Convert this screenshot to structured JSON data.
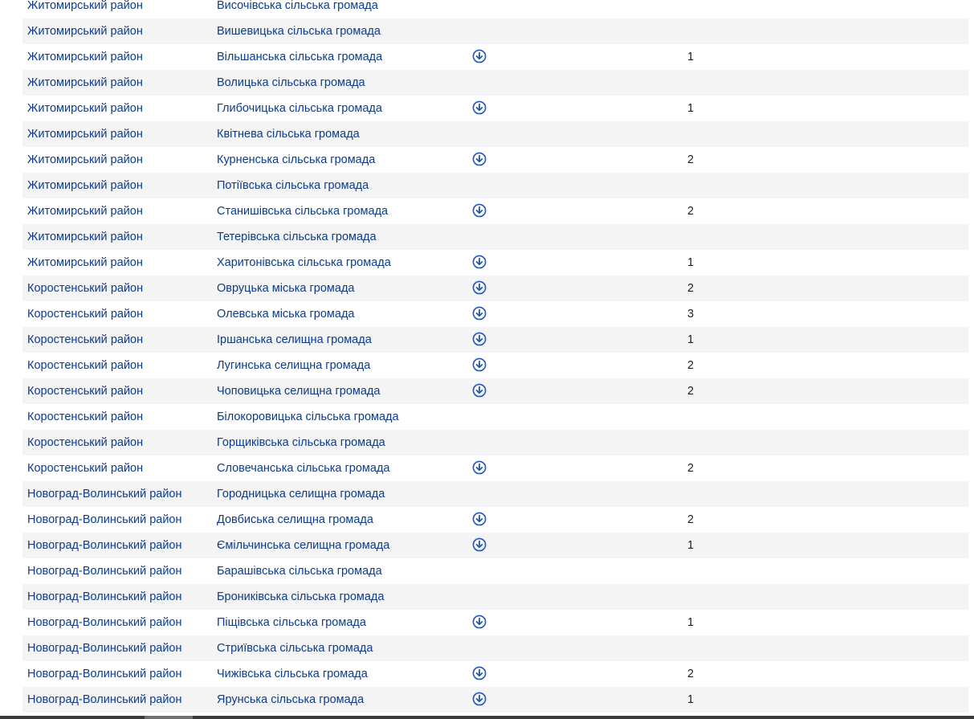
{
  "colors": {
    "link": "#0c3b8c",
    "stripe": "#f4f4f4",
    "icon": "#1f57b8"
  },
  "table": {
    "rows": [
      {
        "district": "Житомирський район",
        "hromada": "Височівська сільська громада",
        "download": false,
        "count": ""
      },
      {
        "district": "Житомирський район",
        "hromada": "Вишевицька сільська громада",
        "download": false,
        "count": ""
      },
      {
        "district": "Житомирський район",
        "hromada": "Вільшанська сільська громада",
        "download": true,
        "count": "1"
      },
      {
        "district": "Житомирський район",
        "hromada": "Волицька сільська громада",
        "download": false,
        "count": ""
      },
      {
        "district": "Житомирський район",
        "hromada": "Глибочицька сільська громада",
        "download": true,
        "count": "1"
      },
      {
        "district": "Житомирський район",
        "hromada": "Квітнева сільська громада",
        "download": false,
        "count": ""
      },
      {
        "district": "Житомирський район",
        "hromada": "Курненська сільська громада",
        "download": true,
        "count": "2"
      },
      {
        "district": "Житомирський район",
        "hromada": "Потіївська сільська громада",
        "download": false,
        "count": ""
      },
      {
        "district": "Житомирський район",
        "hromada": "Станишівська сільська громада",
        "download": true,
        "count": "2"
      },
      {
        "district": "Житомирський район",
        "hromada": "Тетерівська сільська громада",
        "download": false,
        "count": ""
      },
      {
        "district": "Житомирський район",
        "hromada": "Харитонівська сільська громада",
        "download": true,
        "count": "1"
      },
      {
        "district": "Коростенський район",
        "hromada": "Овруцька міська громада",
        "download": true,
        "count": "2"
      },
      {
        "district": "Коростенський район",
        "hromada": "Олевська міська громада",
        "download": true,
        "count": "3"
      },
      {
        "district": "Коростенський район",
        "hromada": "Іршанська селищна громада",
        "download": true,
        "count": "1"
      },
      {
        "district": "Коростенський район",
        "hromada": "Лугинська селищна громада",
        "download": true,
        "count": "2"
      },
      {
        "district": "Коростенський район",
        "hromada": "Чоповицька селищна громада",
        "download": true,
        "count": "2"
      },
      {
        "district": "Коростенський район",
        "hromada": "Білокоровицька сільська громада",
        "download": false,
        "count": ""
      },
      {
        "district": "Коростенський район",
        "hromada": "Горщиківська сільська громада",
        "download": false,
        "count": ""
      },
      {
        "district": "Коростенський район",
        "hromada": "Словечанська сільська громада",
        "download": true,
        "count": "2"
      },
      {
        "district": "Новоград-Волинський район",
        "hromada": "Городницька селищна громада",
        "download": false,
        "count": ""
      },
      {
        "district": "Новоград-Волинський район",
        "hromada": "Довбиська селищна громада",
        "download": true,
        "count": "2"
      },
      {
        "district": "Новоград-Волинський район",
        "hromada": "Ємільчинська селищна громада",
        "download": true,
        "count": "1"
      },
      {
        "district": "Новоград-Волинський район",
        "hromada": "Барашівська сільська громада",
        "download": false,
        "count": ""
      },
      {
        "district": "Новоград-Волинський район",
        "hromada": "Брониківська сільська громада",
        "download": false,
        "count": ""
      },
      {
        "district": "Новоград-Волинський район",
        "hromada": "Піщівська сільська громада",
        "download": true,
        "count": "1"
      },
      {
        "district": "Новоград-Волинський район",
        "hromada": "Стриївська сільська громада",
        "download": false,
        "count": ""
      },
      {
        "district": "Новоград-Волинський район",
        "hromada": "Чижівська сільська громада",
        "download": true,
        "count": "2"
      },
      {
        "district": "Новоград-Волинський район",
        "hromada": "Ярунська сільська громада",
        "download": true,
        "count": "1"
      }
    ]
  }
}
